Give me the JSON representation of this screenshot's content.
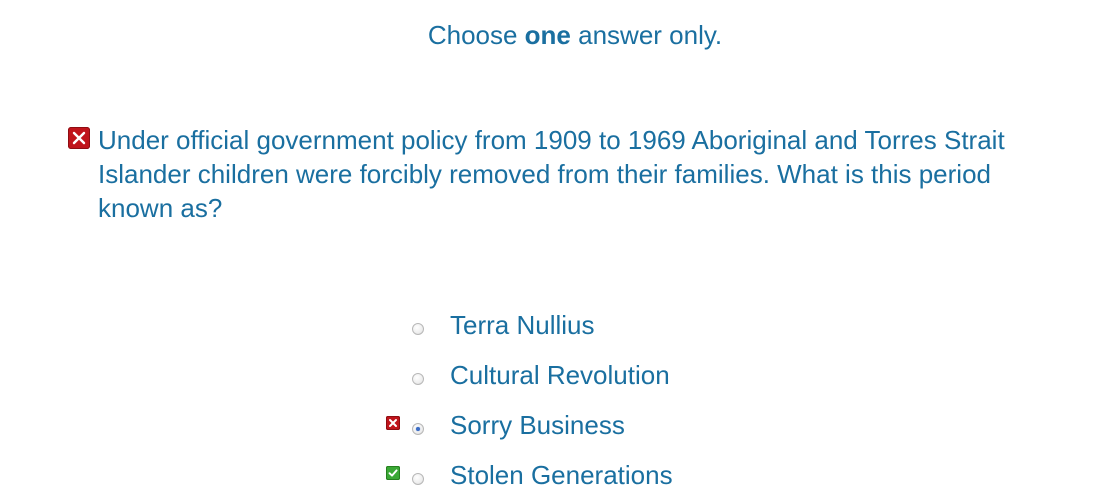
{
  "instruction": {
    "prefix": "Choose ",
    "emphasis": "one",
    "suffix": " answer only."
  },
  "question": {
    "status": "incorrect",
    "status_icon": "x-icon",
    "text": "Under official government policy from 1909 to 1969 Aboriginal and Torres Strait Islander children were forcibly removed from their families. What is this period known as?"
  },
  "options": [
    {
      "label": "Terra Nullius",
      "selected": false,
      "feedback": ""
    },
    {
      "label": "Cultural Revolution",
      "selected": false,
      "feedback": ""
    },
    {
      "label": "Sorry Business",
      "selected": true,
      "feedback": "incorrect"
    },
    {
      "label": "Stolen Generations",
      "selected": false,
      "feedback": "correct"
    }
  ],
  "colors": {
    "text": "#1a6fa0",
    "incorrect": "#c0141b",
    "correct": "#3aa835",
    "radio_selected": "#3b6cc4"
  }
}
